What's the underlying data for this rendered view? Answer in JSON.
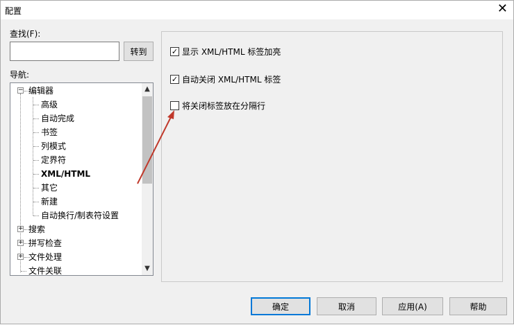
{
  "window": {
    "title": "配置",
    "close_glyph": "✕"
  },
  "find": {
    "label": "查找(F):",
    "value": "",
    "goto_button": "转到"
  },
  "nav": {
    "label": "导航:",
    "tree": {
      "editor": "编辑器",
      "children": [
        "高级",
        "自动完成",
        "书签",
        "列模式",
        "定界符",
        "XML/HTML",
        "其它",
        "新建",
        "自动换行/制表符设置"
      ],
      "selected": "XML/HTML",
      "search": "搜索",
      "spellcheck": "拼写检查",
      "file_handling": "文件处理",
      "file_assoc": "文件关联"
    }
  },
  "options": [
    {
      "label": "显示 XML/HTML 标签加亮",
      "checked": true
    },
    {
      "label": "自动关闭 XML/HTML 标签",
      "checked": true
    },
    {
      "label": "将关闭标签放在分隔行",
      "checked": false
    }
  ],
  "buttons": {
    "ok": "确定",
    "cancel": "取消",
    "apply": "应用(A)",
    "help": "帮助"
  },
  "icons": {
    "expand": "+",
    "collapse": "−",
    "check": "✓",
    "scroll_up": "▲",
    "scroll_down": "▼"
  },
  "colors": {
    "annotation_arrow": "#c0392b",
    "default_button_border": "#0078d7"
  }
}
